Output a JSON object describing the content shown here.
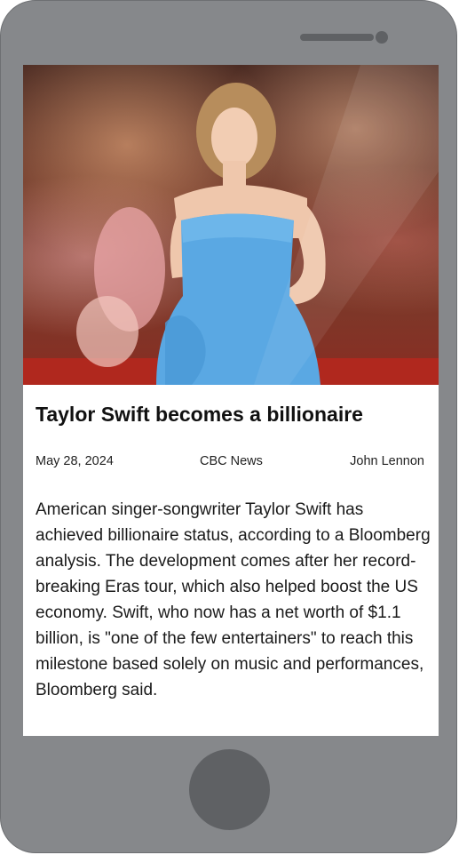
{
  "article": {
    "headline": "Taylor Swift becomes a billionaire",
    "date": "May 28, 2024",
    "source": "CBC News",
    "author": "John Lennon",
    "body": "American singer-songwriter Taylor Swift has achieved billionaire status, according to a Bloomberg analysis. The development comes after her record-breaking Eras tour, which also helped boost the US economy. Swift, who now has a net worth of $1.1 billion, is \"one of the few entertainers\" to reach this milestone based solely on music and performances, Bloomberg said."
  },
  "colors": {
    "device_frame": "#86888b",
    "device_controls": "#5f6164",
    "screen_background": "#ffffff",
    "dress": "#5aa8e3"
  },
  "icons": {
    "speaker": "speaker-grille-icon",
    "camera": "front-camera-icon",
    "home": "home-button"
  }
}
